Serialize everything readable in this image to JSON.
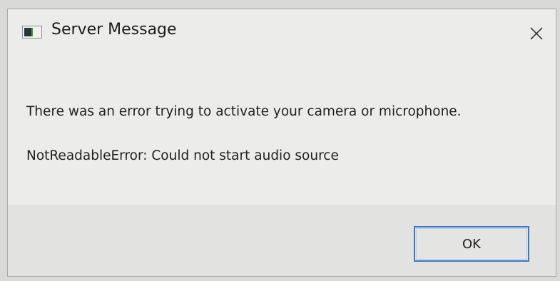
{
  "window": {
    "title": "Server Message",
    "app_icon": "app-window-icon",
    "close_icon": "close-icon"
  },
  "body": {
    "message_line1": "There was an error trying to activate your camera or microphone.",
    "message_line2": "NotReadableError: Could not start audio source"
  },
  "buttons": {
    "ok_label": "OK"
  },
  "colors": {
    "accent": "#3c78c8",
    "dialog_bg": "#ececea",
    "footer_bg": "#e2e2e0"
  }
}
